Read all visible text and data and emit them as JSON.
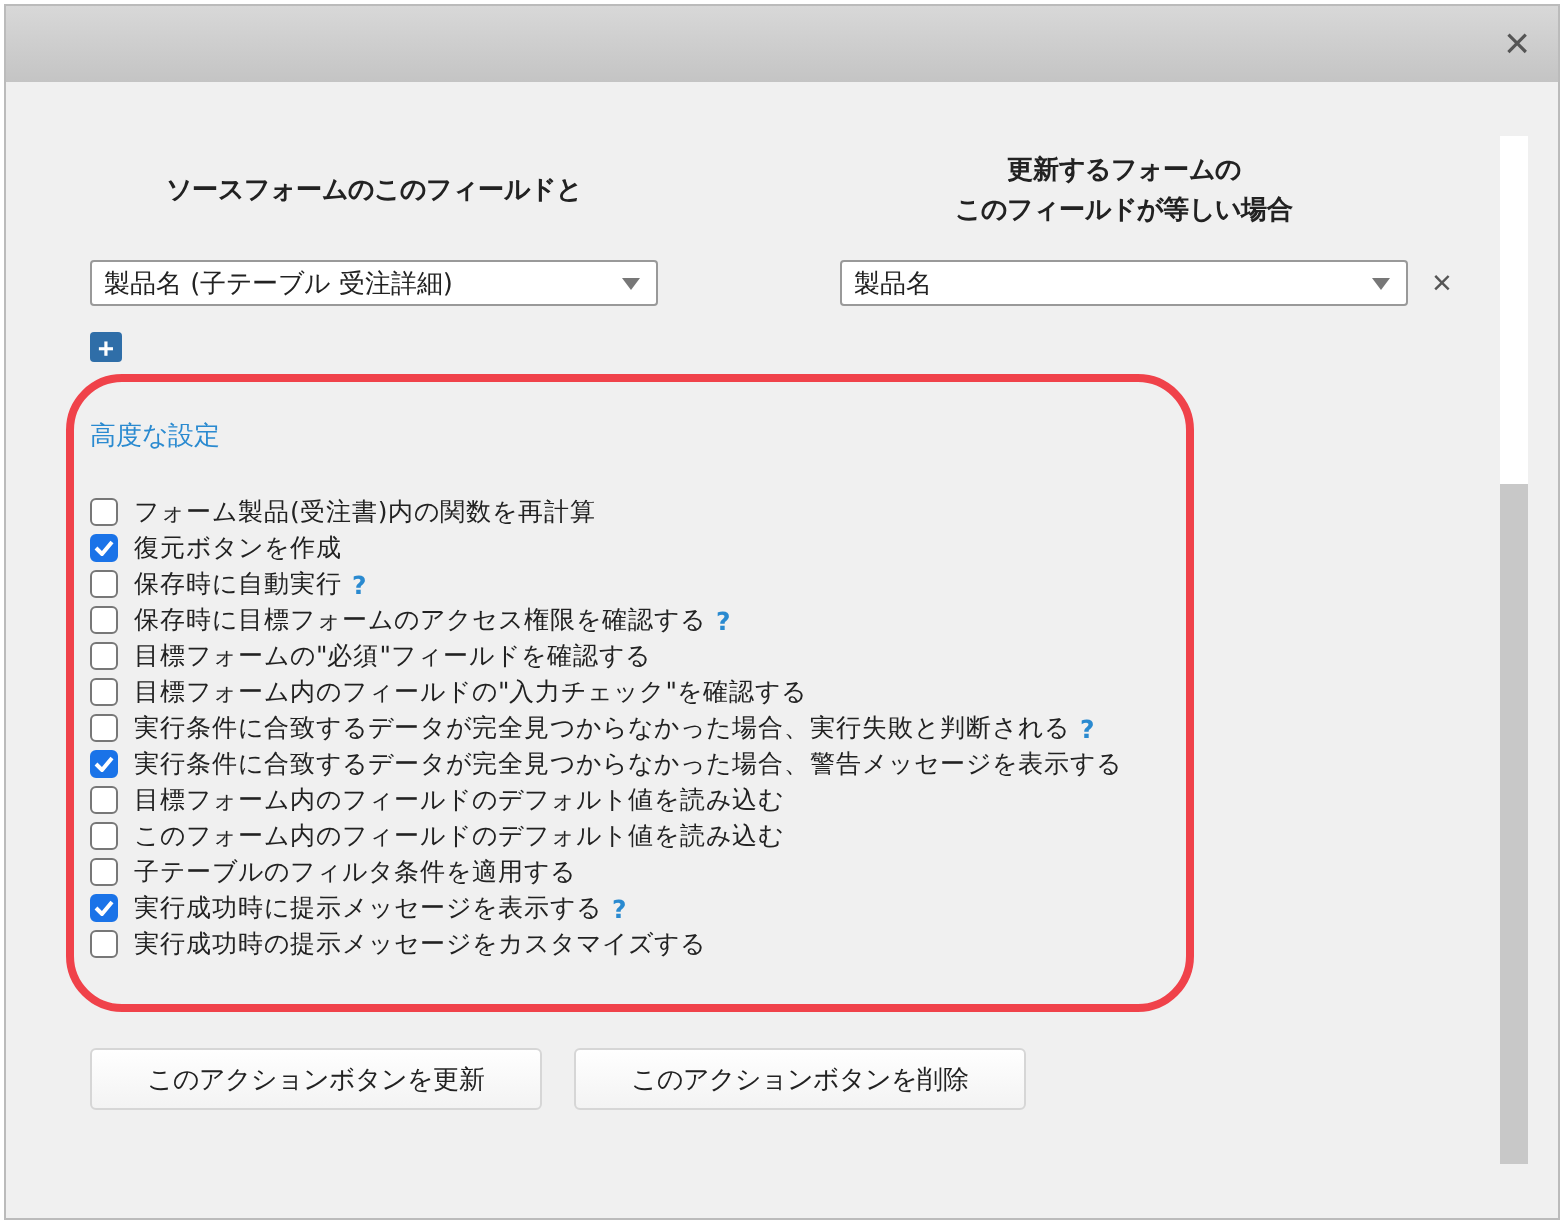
{
  "dialog": {
    "close": "×"
  },
  "mapping": {
    "source_heading": "ソースフォームのこのフィールドと",
    "target_heading_lines": [
      "更新するフォームの",
      "このフィールドが等しい場合"
    ],
    "rows": [
      {
        "source": "製品名 (子テーブル 受注詳細)",
        "target": "製品名",
        "remove": "×"
      }
    ],
    "add": "+"
  },
  "advanced": {
    "title": "高度な設定",
    "highlighted": true,
    "options": [
      {
        "label": "フォーム製品(受注書)内の関数を再計算",
        "checked": false
      },
      {
        "label": "復元ボタンを作成",
        "checked": true
      },
      {
        "label": "保存時に自動実行",
        "checked": false,
        "help": "?"
      },
      {
        "label": "保存時に目標フォームのアクセス権限を確認する",
        "checked": false,
        "help": "?"
      },
      {
        "label": "目標フォームの\"必須\"フィールドを確認する",
        "checked": false
      },
      {
        "label": "目標フォーム内のフィールドの\"入力チェック\"を確認する",
        "checked": false
      },
      {
        "label": "実行条件に合致するデータが完全見つからなかった場合、実行失敗と判断される",
        "checked": false,
        "help": "?"
      },
      {
        "label": "実行条件に合致するデータが完全見つからなかった場合、警告メッセージを表示する",
        "checked": true
      },
      {
        "label": "目標フォーム内のフィールドのデフォルト値を読み込む",
        "checked": false
      },
      {
        "label": "このフォーム内のフィールドのデフォルト値を読み込む",
        "checked": false
      },
      {
        "label": "子テーブルのフィルタ条件を適用する",
        "checked": false
      },
      {
        "label": "実行成功時に提示メッセージを表示する",
        "checked": true,
        "help": "?"
      },
      {
        "label": "実行成功時の提示メッセージをカスタマイズする",
        "checked": false
      }
    ]
  },
  "buttons": [
    "このアクションボタンを更新",
    "このアクションボタンを削除"
  ]
}
